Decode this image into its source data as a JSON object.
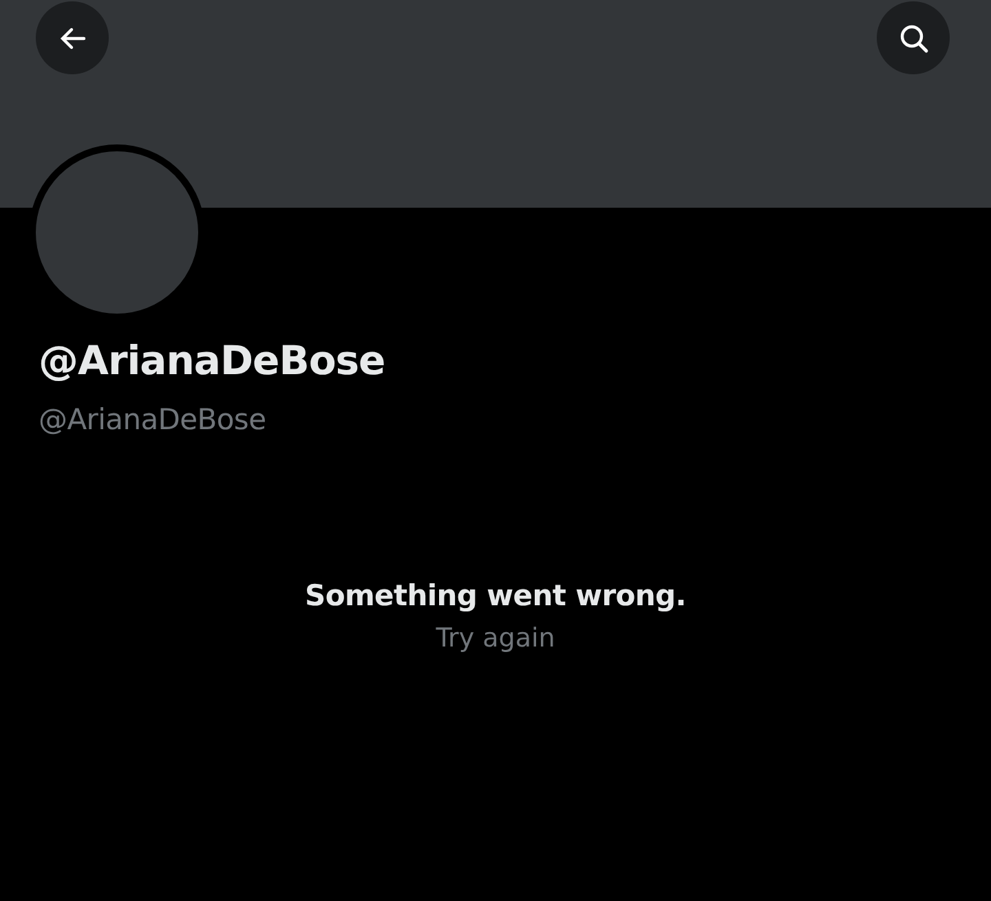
{
  "profile": {
    "display_name": "@ArianaDeBose",
    "handle": "@ArianaDeBose"
  },
  "error": {
    "message": "Something went wrong.",
    "action": "Try again"
  }
}
